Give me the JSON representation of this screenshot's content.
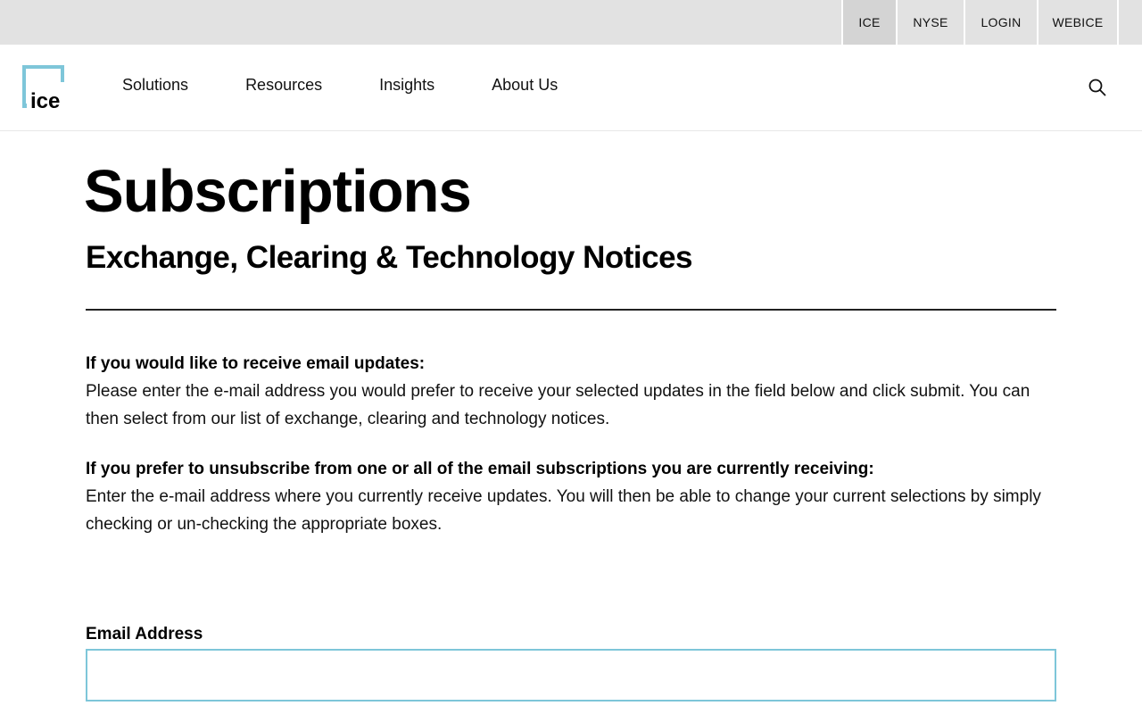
{
  "utility_bar": {
    "links": [
      {
        "label": "ICE",
        "active": true
      },
      {
        "label": "NYSE",
        "active": false
      },
      {
        "label": "LOGIN",
        "active": false
      },
      {
        "label": "WEBICE",
        "active": false
      }
    ]
  },
  "nav": {
    "logo_text": "ice",
    "items": [
      "Solutions",
      "Resources",
      "Insights",
      "About Us"
    ],
    "search_icon": "search-icon"
  },
  "page": {
    "title": "Subscriptions",
    "subtitle": "Exchange, Clearing & Technology Notices"
  },
  "info": [
    {
      "heading": "If you would like to receive email updates:",
      "text": "Please enter the e-mail address you would prefer to receive your selected updates in the field below and click submit. You can then select from our list of exchange, clearing and technology notices."
    },
    {
      "heading": "If you prefer to unsubscribe from one or all of the email subscriptions you are currently receiving:",
      "text": "Enter the e-mail address where you currently receive updates. You will then be able to change your current selections by simply checking or un-checking the appropriate boxes."
    }
  ],
  "form": {
    "email_label": "Email Address",
    "email_value": "",
    "email_placeholder": ""
  },
  "colors": {
    "brand_accent": "#7ec6d9",
    "utility_bar_bg": "#e2e2e2",
    "active_utility_bg": "#d4d4d4"
  }
}
